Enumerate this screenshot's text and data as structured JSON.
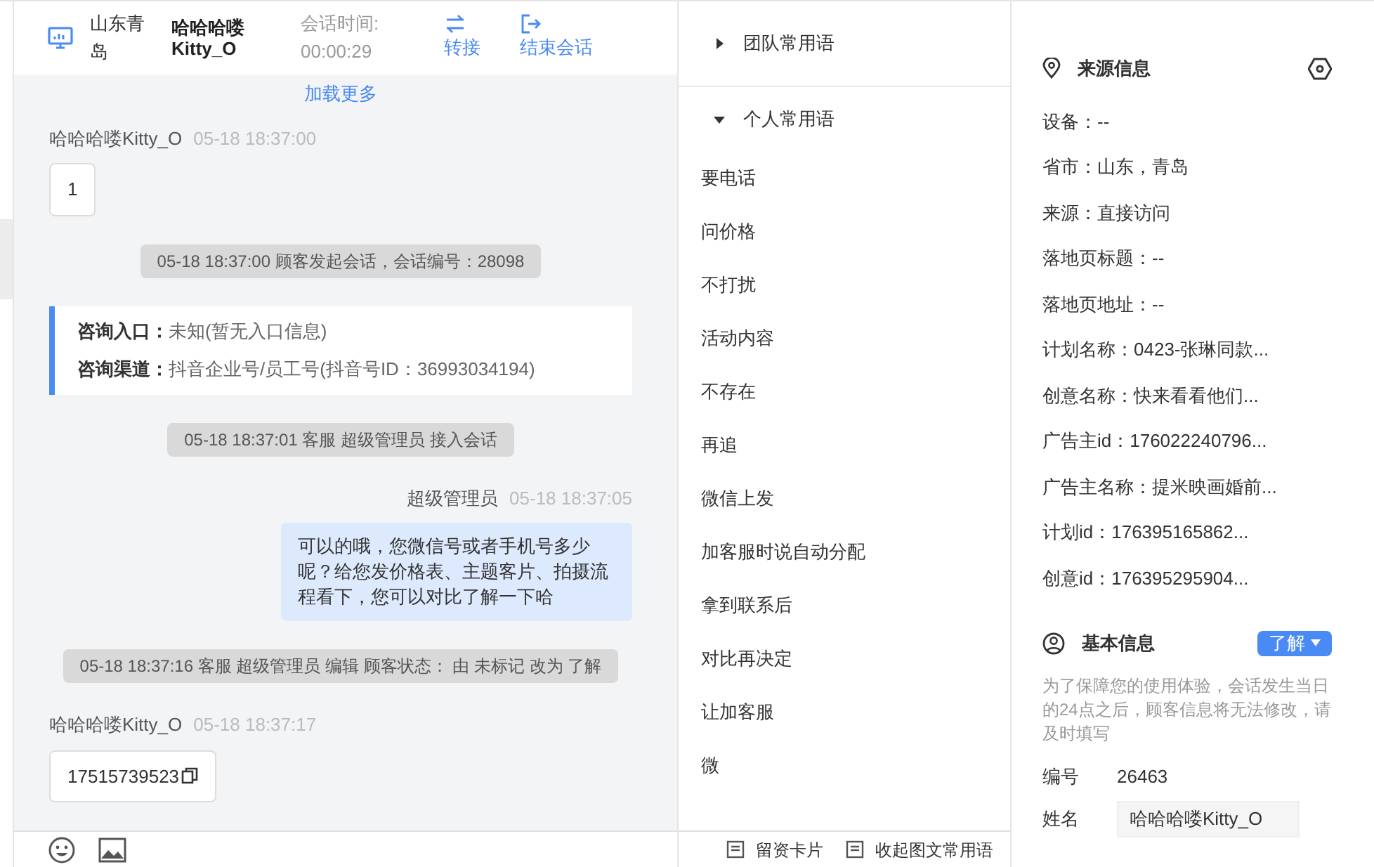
{
  "header": {
    "location": "山东青岛",
    "customer": "哈哈哈喽Kitty_O",
    "session_time_label": "会话时间:",
    "session_time": "00:00:29",
    "actions": [
      {
        "label": "转接",
        "kind": "transfer"
      },
      {
        "label": "结束会话",
        "kind": "end"
      }
    ]
  },
  "chat": {
    "load_more": "加载更多",
    "messages": [
      {
        "kind": "incoming",
        "sender": "哈哈哈喽Kitty_O",
        "time": "05-18 18:37:00",
        "text": "1",
        "copyable": false
      },
      {
        "kind": "system",
        "text": "05-18 18:37:00 顾客发起会话，会话编号：28098"
      },
      {
        "kind": "info",
        "rows": [
          {
            "label": "咨询入口：",
            "value": "未知(暂无入口信息)"
          },
          {
            "label": "咨询渠道：",
            "value": "抖音企业号/员工号(抖音号ID：36993034194)"
          }
        ]
      },
      {
        "kind": "system",
        "text": "05-18 18:37:01 客服 超级管理员 接入会话"
      },
      {
        "kind": "outgoing",
        "sender": "超级管理员",
        "time": "05-18 18:37:05",
        "text": "可以的哦，您微信号或者手机号多少呢？给您发价格表、主题客片、拍摄流程看下，您可以对比了解一下哈"
      },
      {
        "kind": "system",
        "text": "05-18 18:37:16 客服 超级管理员 编辑 顾客状态： 由 未标记 改为 了解"
      },
      {
        "kind": "incoming",
        "sender": "哈哈哈喽Kitty_O",
        "time": "05-18 18:37:17",
        "text": "17515739523",
        "copyable": true
      }
    ]
  },
  "quick_phrases": {
    "groups": [
      {
        "title": "团队常用语",
        "expanded": false
      },
      {
        "title": "个人常用语",
        "expanded": true,
        "items": [
          "要电话",
          "问价格",
          "不打扰",
          "活动内容",
          "不存在",
          "再追",
          "微信上发",
          "加客服时说自动分配",
          "拿到联系后",
          "对比再决定",
          "让加客服",
          "微"
        ]
      }
    ],
    "footer_buttons": [
      "留资卡片",
      "收起图文常用语"
    ]
  },
  "source_info": {
    "title": "来源信息",
    "fields": [
      "设备：--",
      "省市：山东，青岛",
      "来源：直接访问",
      "落地页标题：--",
      "落地页地址：--",
      "计划名称：0423-张琳同款...",
      "创意名称：快来看看他们...",
      "广告主id：176022240796...",
      "广告主名称：提米映画婚前...",
      "计划id：176395165862...",
      "创意id：176395295904..."
    ]
  },
  "basic_info": {
    "title": "基本信息",
    "status": "了解",
    "notice": "为了保障您的使用体验，会话发生当日的24点之后，顾客信息将无法修改，请及时填写",
    "fields": [
      {
        "kind": "text",
        "label": "编号",
        "value": "26463"
      },
      {
        "kind": "input",
        "label": "姓名",
        "value": "哈哈哈喽Kitty_O"
      }
    ]
  }
}
